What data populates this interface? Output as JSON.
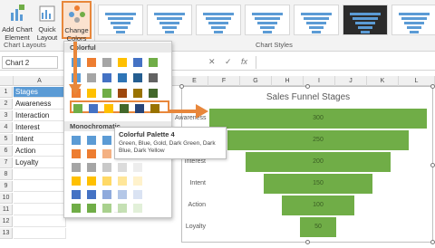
{
  "ribbon": {
    "add_chart_element": "Add Chart\nElement",
    "quick_layout": "Quick\nLayout",
    "change_colors": "Change\nColors",
    "chart_layouts_label": "Chart Layouts",
    "chart_styles_label": "Chart Styles"
  },
  "formula_bar": {
    "name_box": "Chart 2",
    "fx": "fx"
  },
  "columns": [
    "A",
    "E",
    "F",
    "G",
    "H",
    "I",
    "J",
    "K",
    "L"
  ],
  "rows": [
    "1",
    "2",
    "3",
    "4",
    "5",
    "6",
    "7",
    "8",
    "9",
    "10",
    "11",
    "12",
    "13"
  ],
  "cells": [
    "Stages",
    "Awareness",
    "Interaction",
    "Interest",
    "Intent",
    "Action",
    "Loyalty"
  ],
  "dropdown": {
    "colorful_label": "Colorful",
    "monochromatic_label": "Monochromatic",
    "colorful_palettes": [
      [
        "#5b9bd5",
        "#ed7d31",
        "#a5a5a5",
        "#ffc000",
        "#4472c4",
        "#70ad47"
      ],
      [
        "#5b9bd5",
        "#a5a5a5",
        "#4472c4",
        "#2e75b6",
        "#255e91",
        "#636363"
      ],
      [
        "#ed7d31",
        "#ffc000",
        "#70ad47",
        "#9e480e",
        "#997300",
        "#43682b"
      ],
      [
        "#70ad47",
        "#4472c4",
        "#ffc000",
        "#43682b",
        "#264478",
        "#997300"
      ]
    ],
    "mono_palettes": [
      [
        "#5b9bd5",
        "#5b9bd5",
        "#5b9bd5",
        "#9dc3e6",
        "#bdd7ee"
      ],
      [
        "#ed7d31",
        "#ed7d31",
        "#f4b183",
        "#f8cbad",
        "#fbe5d6"
      ],
      [
        "#a5a5a5",
        "#a5a5a5",
        "#c9c9c9",
        "#dbdbdb",
        "#ededed"
      ],
      [
        "#ffc000",
        "#ffc000",
        "#ffd966",
        "#ffe699",
        "#fff2cc"
      ],
      [
        "#4472c4",
        "#4472c4",
        "#8faadc",
        "#b4c7e7",
        "#dae3f3"
      ],
      [
        "#70ad47",
        "#70ad47",
        "#a9d18e",
        "#c5e0b4",
        "#e2f0d9"
      ]
    ]
  },
  "tooltip": {
    "title": "Colorful Palette 4",
    "description": "Green, Blue, Gold, Dark Green, Dark Blue, Dark Yellow"
  },
  "chart_data": {
    "type": "bar",
    "title": "Sales Funnel Stages",
    "categories": [
      "Awareness",
      "Interaction",
      "Interest",
      "Intent",
      "Action",
      "Loyalty"
    ],
    "values": [
      300,
      250,
      200,
      150,
      100,
      50
    ],
    "bar_color": "#70ad47"
  },
  "colors": {
    "accent_orange": "#e8873b",
    "header_blue": "#5b9bd5"
  }
}
